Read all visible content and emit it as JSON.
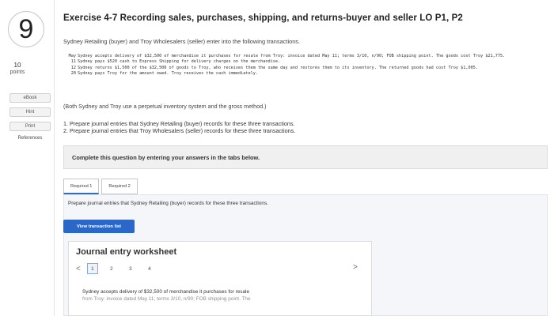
{
  "question": {
    "number": "9",
    "points_value": "10",
    "points_label": "points",
    "sidebar_buttons": [
      "eBook",
      "Hint",
      "Print"
    ],
    "references_label": "References"
  },
  "header": {
    "title": "Exercise 4-7 Recording sales, purchases, shipping, and returns-buyer and seller LO P1, P2"
  },
  "problem": {
    "intro": "Sydney Retailing (buyer) and Troy Wholesalers (seller) enter into the following transactions.",
    "transactions": [
      {
        "day": "May 11",
        "text": "Sydney accepts delivery of $32,500 of merchandise it purchases for resale from Troy: invoice dated May 11; terms 3/10, n/90; FOB shipping point. The goods cost Troy $21,775. Sydney pays $520 cash to Express Shipping for delivery charges on the merchandise."
      },
      {
        "day": "12",
        "text": "Sydney returns $1,500 of the $32,500 of goods to Troy, who receives them the same day and restores them to its inventory. The returned goods had cost Troy $1,005."
      },
      {
        "day": "20",
        "text": "Sydney pays Troy for the amount owed. Troy receives the cash immediately."
      }
    ],
    "note": "(Both Sydney and Troy use a perpetual inventory system and the gross method.)",
    "requirements": [
      "1. Prepare journal entries that Sydney Retailing (buyer) records for these three transactions.",
      "2. Prepare journal entries that Troy Wholesalers (seller) records for these three transactions."
    ]
  },
  "instruction": "Complete this question by entering your answers in the tabs below.",
  "tabs": [
    "Required 1",
    "Required 2"
  ],
  "sub_instruction": "Prepare journal entries that Sydney Retailing (buyer) records for these three transactions.",
  "view_button_label": "View transaction list",
  "worksheet": {
    "title": "Journal entry worksheet",
    "pages": [
      "1",
      "2",
      "3",
      "4"
    ],
    "prev_arrow": "<",
    "next_arrow": ">",
    "description_line1": "Sydney accepts delivery of $32,500 of merchandise it purchases for resale",
    "description_line2": "from Troy: invoice dated May 11; terms 3/10, n/90; FOB shipping point. The"
  }
}
